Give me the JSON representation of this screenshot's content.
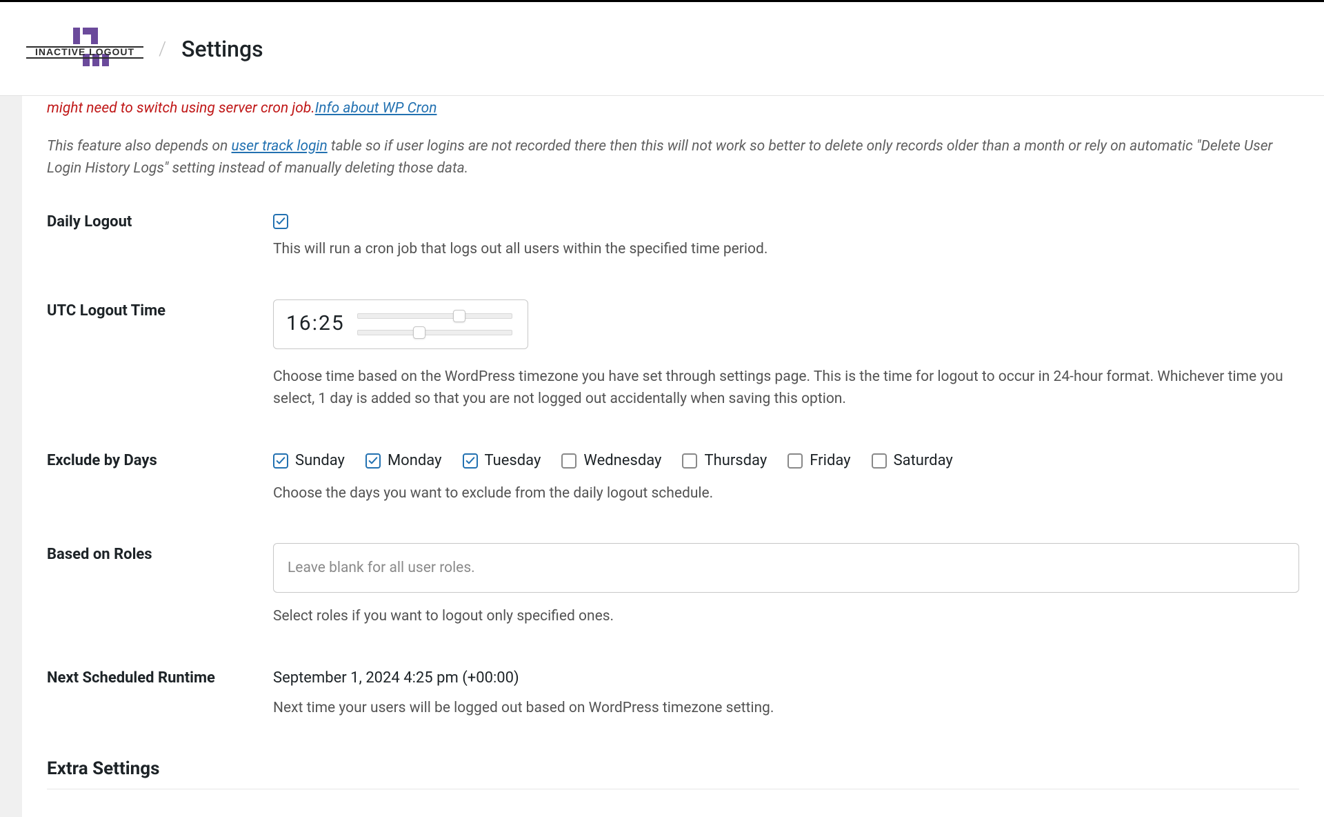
{
  "header": {
    "brand_top": "INACTIVE LOGOUT",
    "page_title": "Settings"
  },
  "warning": {
    "tail": "might need to switch using server cron job.",
    "link_text": "Info about WP Cron"
  },
  "feature_note": {
    "before_link": "This feature also depends on ",
    "link_text": "user track login",
    "after_link": " table so if user logins are not recorded there then this will not work so better to delete only records older than a month or rely on automatic \"Delete User Login History Logs\" setting instead of manually deleting those data."
  },
  "daily_logout": {
    "label": "Daily Logout",
    "checked": true,
    "help": "This will run a cron job that logs out all users within the specified time period."
  },
  "utc_time": {
    "label": "UTC Logout Time",
    "value": "16:25",
    "help": "Choose time based on the WordPress timezone you have set through settings page. This is the time for logout to occur in 24-hour format. Whichever time you select, 1 day is added so that you are not logged out accidentally when saving this option."
  },
  "exclude_days": {
    "label": "Exclude by Days",
    "help": "Choose the days you want to exclude from the daily logout schedule.",
    "days": [
      {
        "name": "Sunday",
        "checked": true
      },
      {
        "name": "Monday",
        "checked": true
      },
      {
        "name": "Tuesday",
        "checked": true
      },
      {
        "name": "Wednesday",
        "checked": false
      },
      {
        "name": "Thursday",
        "checked": false
      },
      {
        "name": "Friday",
        "checked": false
      },
      {
        "name": "Saturday",
        "checked": false
      }
    ]
  },
  "roles": {
    "label": "Based on Roles",
    "placeholder": "Leave blank for all user roles.",
    "help": "Select roles if you want to logout only specified ones."
  },
  "next_runtime": {
    "label": "Next Scheduled Runtime",
    "value": "September 1, 2024 4:25 pm (+00:00)",
    "help": "Next time your users will be logged out based on WordPress timezone setting."
  },
  "extra": {
    "heading": "Extra Settings"
  }
}
